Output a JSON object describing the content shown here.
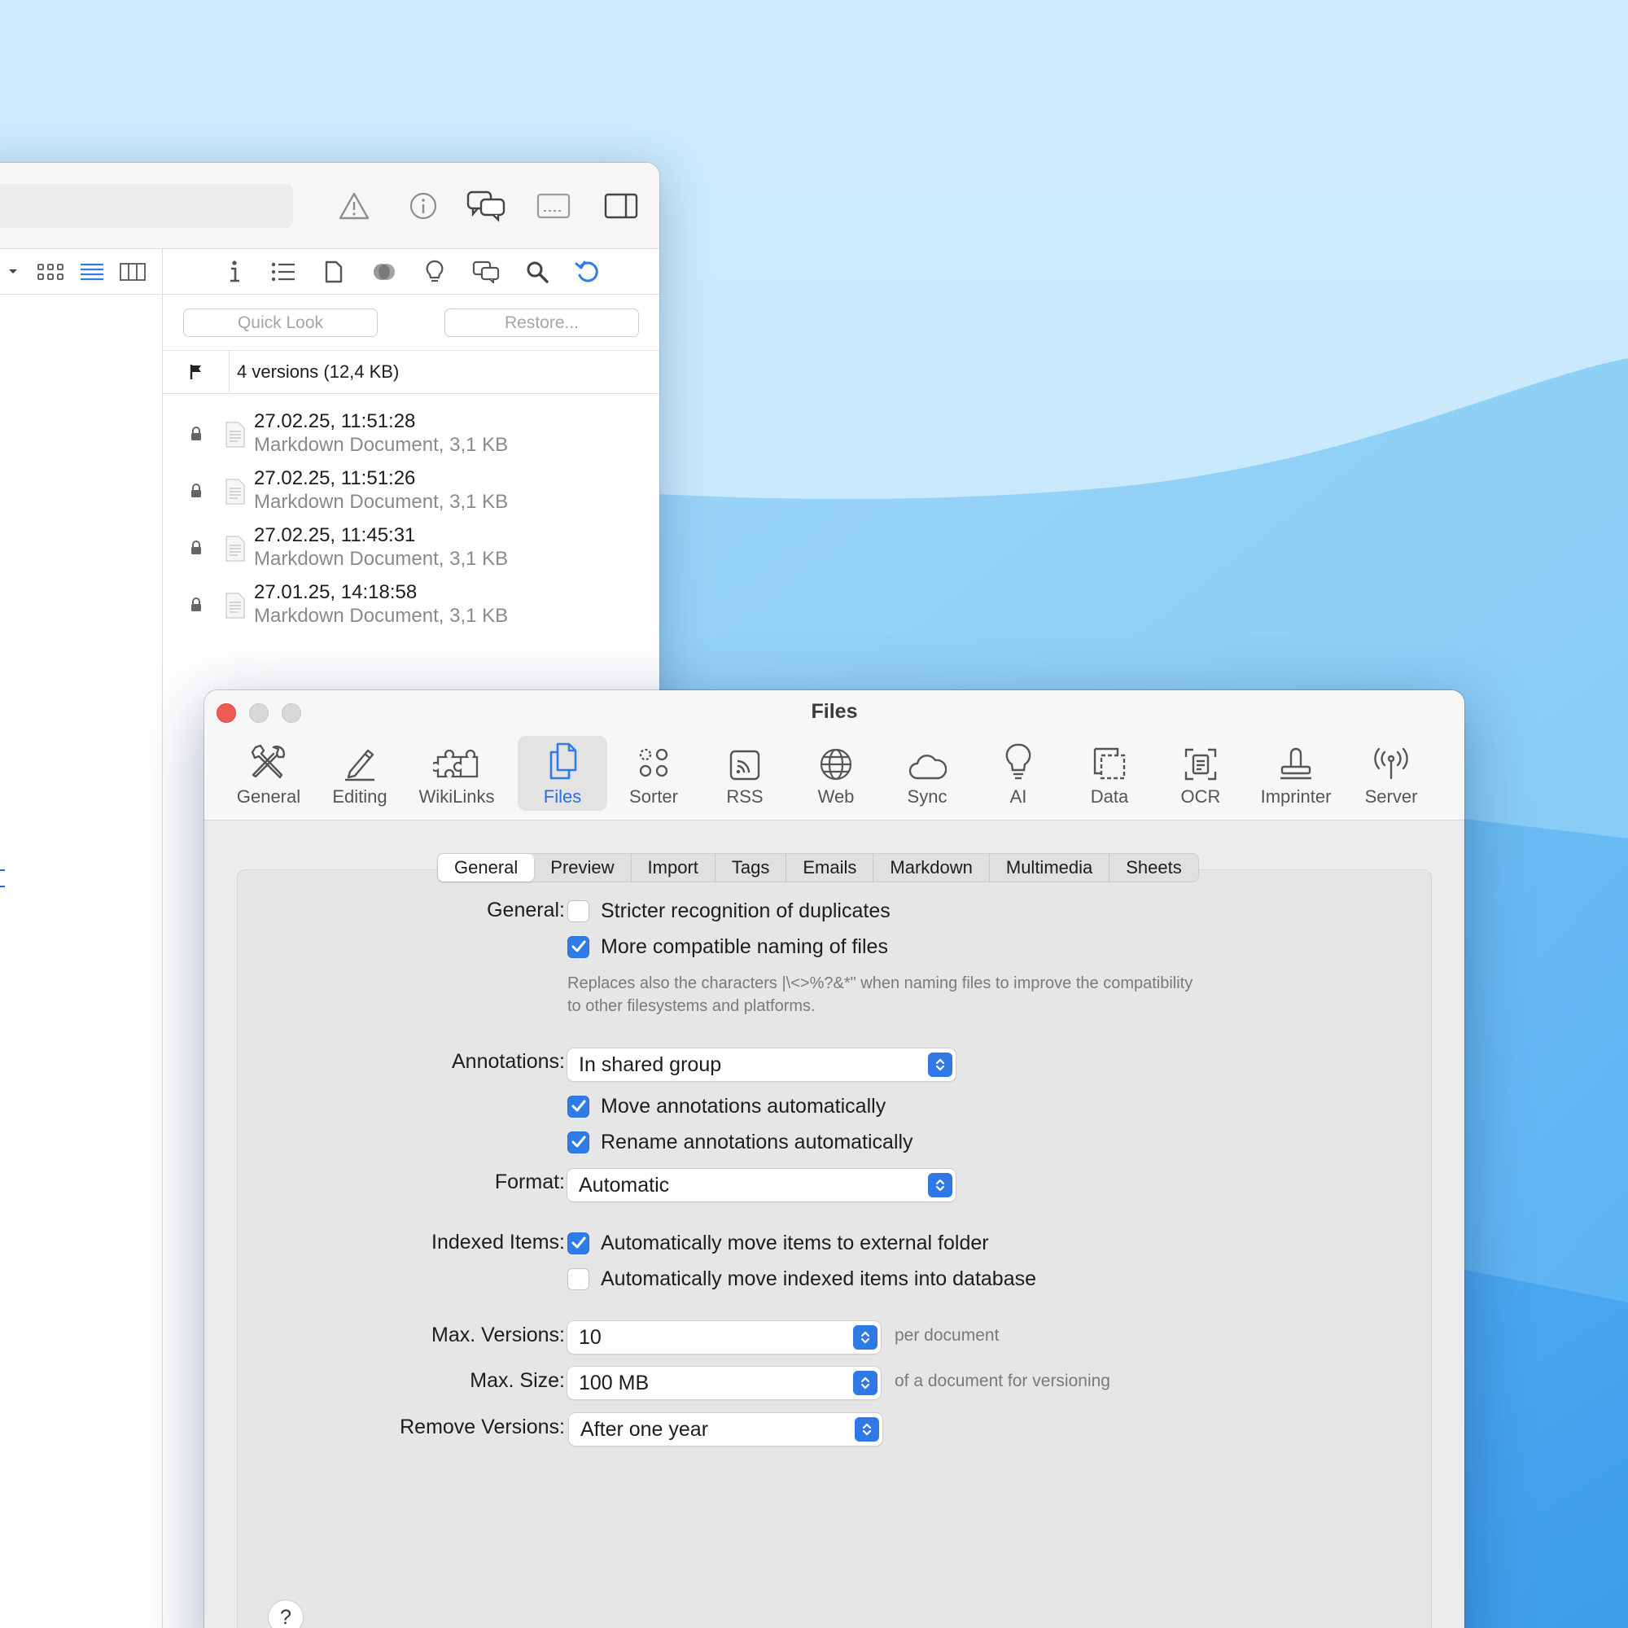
{
  "versions_panel": {
    "quick_look_label": "Quick Look",
    "restore_label": "Restore...",
    "versions_summary": "4 versions (12,4 KB)",
    "versions": [
      {
        "date": "27.02.25, 11:51:28",
        "meta": "Markdown Document, 3,1 KB"
      },
      {
        "date": "27.02.25, 11:51:26",
        "meta": "Markdown Document, 3,1 KB"
      },
      {
        "date": "27.02.25, 11:45:31",
        "meta": "Markdown Document, 3,1 KB"
      },
      {
        "date": "27.01.25, 14:18:58",
        "meta": "Markdown Document, 3,1 KB"
      }
    ]
  },
  "prefs_window": {
    "title": "Files",
    "tabs": [
      {
        "label": "General",
        "icon": "tools-icon"
      },
      {
        "label": "Editing",
        "icon": "pencil-icon"
      },
      {
        "label": "WikiLinks",
        "icon": "puzzle-icon"
      },
      {
        "label": "Files",
        "icon": "files-icon"
      },
      {
        "label": "Sorter",
        "icon": "sorter-icon"
      },
      {
        "label": "RSS",
        "icon": "rss-icon"
      },
      {
        "label": "Web",
        "icon": "globe-icon"
      },
      {
        "label": "Sync",
        "icon": "cloud-icon"
      },
      {
        "label": "AI",
        "icon": "lightbulb-icon"
      },
      {
        "label": "Data",
        "icon": "data-icon"
      },
      {
        "label": "OCR",
        "icon": "ocr-icon"
      },
      {
        "label": "Imprinter",
        "icon": "stamp-icon"
      },
      {
        "label": "Server",
        "icon": "antenna-icon"
      }
    ],
    "active_tab": "Files",
    "subtabs": [
      "General",
      "Preview",
      "Import",
      "Tags",
      "Emails",
      "Markdown",
      "Multimedia",
      "Sheets"
    ],
    "active_subtab": "General",
    "general": {
      "label": "General:",
      "stricter_duplicates": {
        "label": "Stricter recognition of duplicates",
        "checked": false
      },
      "compatible_naming": {
        "label": "More compatible naming of files",
        "checked": true
      },
      "hint_line1": "Replaces also the characters |\\<>%?&*\" when naming files to improve the compatibility",
      "hint_line2": "to other filesystems and platforms."
    },
    "annotations": {
      "label": "Annotations:",
      "value": "In shared group",
      "move_auto": {
        "label": "Move annotations automatically",
        "checked": true
      },
      "rename_auto": {
        "label": "Rename annotations automatically",
        "checked": true
      }
    },
    "format": {
      "label": "Format:",
      "value": "Automatic"
    },
    "indexed_items": {
      "label": "Indexed Items:",
      "move_external": {
        "label": "Automatically move items to external folder",
        "checked": true
      },
      "move_into_db": {
        "label": "Automatically move indexed items into database",
        "checked": false
      }
    },
    "max_versions": {
      "label": "Max. Versions:",
      "value": "10",
      "suffix": "per document"
    },
    "max_size": {
      "label": "Max. Size:",
      "value": "100 MB",
      "suffix": "of a document for versioning"
    },
    "remove_versions": {
      "label": "Remove Versions:",
      "value": "After one year"
    },
    "help_label": "?"
  },
  "colors": {
    "accent": "#2f7be8",
    "close_button": "#ee5c53",
    "wallpaper_light": "#c4e5fb",
    "wallpaper_deep": "#4aa8f0"
  }
}
